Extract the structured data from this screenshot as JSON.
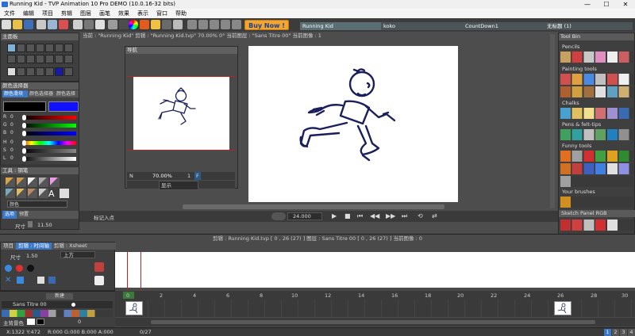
{
  "window": {
    "title": "Running Kid - TVP Animation 10 Pro DEMO (10.0.16-32 bits)",
    "controls": [
      "—",
      "☐",
      "✕"
    ]
  },
  "menu": [
    "文件",
    "编辑",
    "项目",
    "剪辑",
    "图层",
    "画笔",
    "效果",
    "表示",
    "窗口",
    "帮助"
  ],
  "toolbar": {
    "buy_now": "Buy Now !"
  },
  "tabs": [
    {
      "label": "Running Kid"
    },
    {
      "label": "koko"
    },
    {
      "label": "CountDown1"
    },
    {
      "label": "无标题 (1)"
    }
  ],
  "canvas_info": "当前 : \"Running Kid\"  剪辑 : \"Running Kid.tvp\"  70.00%  0°  当前图层 : \"Sans Titre 00\"  当前图像 : 1",
  "navigator": {
    "title": "导航",
    "zoom_label": "N",
    "zoom_value": "70.00%",
    "page_num": "1",
    "flag": "F",
    "display_label": "显示"
  },
  "left_panels": {
    "main_panel": "主面板",
    "color_selector": "颜色选择器",
    "color_tabs": [
      "颜色滑块",
      "颜色选择器",
      "颜色选择"
    ],
    "sliders": [
      {
        "label": "R",
        "value": "0"
      },
      {
        "label": "G",
        "value": "0"
      },
      {
        "label": "B",
        "value": "0"
      },
      {
        "label": "H",
        "value": "0"
      },
      {
        "label": "S",
        "value": "0"
      },
      {
        "label": "L",
        "value": "0"
      }
    ],
    "tools_panel": "工具 : 钢笔",
    "color_select": "颜色",
    "tabs": [
      "选项",
      "预置"
    ],
    "size_label": "尺寸",
    "size_value": "11.50"
  },
  "playback": {
    "fps": "24.000",
    "marker": "标记入点"
  },
  "timeline_header": "剪辑 : Running Kid.tvp [ 0 , 26  (27) ]      图层 : Sans Titre 00 [ 0 , 26  (27) ]      当前图像 : 0",
  "timeline": {
    "tabs": [
      "项目",
      "剪辑 : 时间轴",
      "剪辑 : Xsheet"
    ],
    "size_label": "尺寸",
    "size_value": "1.50",
    "position_label": "上方",
    "new_button": "新建",
    "layer_name": "Sans Titre 00",
    "main_color_label": "主背景色",
    "ruler": [
      "0",
      "2",
      "4",
      "6",
      "8",
      "10",
      "12",
      "14",
      "16",
      "18",
      "20",
      "22",
      "24",
      "26",
      "28",
      "30"
    ],
    "opacity_value": "0"
  },
  "toolbin": {
    "title": "Tool Bin",
    "sections": [
      "Pencils",
      "Painting tools",
      "Chalks",
      "Pens & felt-tips",
      "Funny tools",
      "Your brushes"
    ],
    "sketch_panel": "Sketch Panel RGB"
  },
  "status": {
    "coords": "X:1322 Y:472",
    "rgba": "R:000 G:000 B:000 A:000",
    "frame": "0/27",
    "pages": [
      "1",
      "2",
      "3",
      "4"
    ]
  },
  "colors": {
    "accent": "#3c78c8",
    "canvas": "#ffffff",
    "stroke": "#1a1f5c",
    "red_line": "#c02020"
  }
}
